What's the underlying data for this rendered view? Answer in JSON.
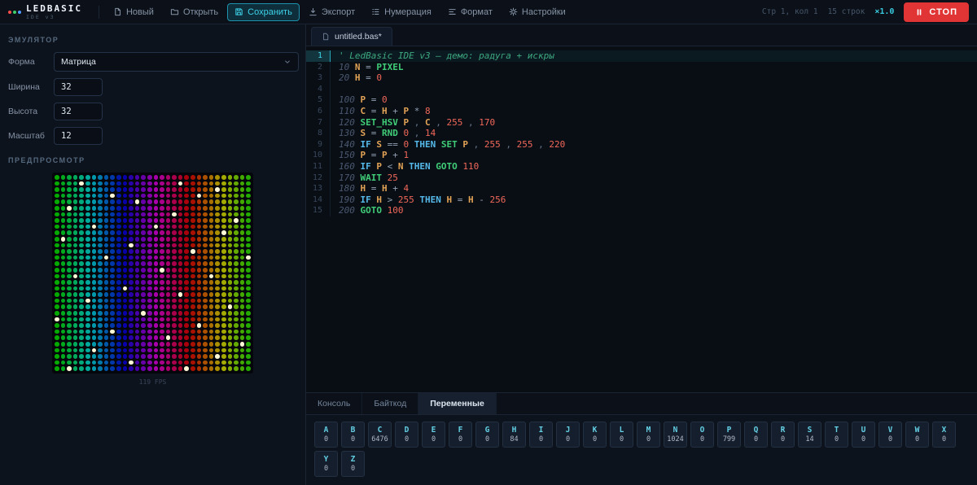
{
  "colors": {
    "accent": "#3ed2e9",
    "stop": "#e13434",
    "spark": "#fff7d6"
  },
  "toolbar": {
    "logo": "LEDBASIC",
    "logo_sub": "IDE v3",
    "logo_dot_colors": [
      "#ff4d4d",
      "#3fd06b",
      "#4d9bff"
    ],
    "buttons": [
      {
        "key": "new",
        "icon": "new-file",
        "label": "Новый"
      },
      {
        "key": "open",
        "icon": "open-folder",
        "label": "Открыть"
      },
      {
        "key": "save",
        "icon": "save",
        "label": "Сохранить",
        "active": true
      },
      {
        "key": "export",
        "icon": "export",
        "label": "Экспорт"
      },
      {
        "key": "numbering",
        "icon": "numbering",
        "label": "Нумерация"
      },
      {
        "key": "format",
        "icon": "format",
        "label": "Формат"
      },
      {
        "key": "settings",
        "icon": "gear",
        "label": "Настройки"
      }
    ],
    "cursor_status": "Стр 1, кол 1",
    "line_count": "15 строк",
    "speed": "×1.0",
    "stop_label": "СТОП"
  },
  "sidebar": {
    "emulator_header": "ЭМУЛЯТОР",
    "fields": [
      {
        "key": "shape",
        "label": "Форма",
        "value": "Матрица",
        "type": "select"
      },
      {
        "key": "width",
        "label": "Ширина",
        "value": "32",
        "type": "input"
      },
      {
        "key": "height",
        "label": "Высота",
        "value": "32",
        "type": "input"
      },
      {
        "key": "scale",
        "label": "Масштаб",
        "value": "12",
        "type": "input"
      }
    ],
    "preview_header": "ПРЕДПРОСМОТР",
    "fps": "119 FPS",
    "matrix": {
      "cols": 32,
      "rows": 32,
      "hue_base": 84,
      "hue_step": 8,
      "saturation": 255,
      "brightness": 170,
      "spark_color": "#fff7d6",
      "sparks": [
        [
          4,
          1
        ],
        [
          20,
          1
        ],
        [
          26,
          2
        ],
        [
          9,
          3
        ],
        [
          23,
          3
        ],
        [
          13,
          4
        ],
        [
          2,
          5
        ],
        [
          19,
          6
        ],
        [
          29,
          7
        ],
        [
          6,
          8
        ],
        [
          16,
          8
        ],
        [
          27,
          9
        ],
        [
          1,
          10
        ],
        [
          12,
          11
        ],
        [
          22,
          12
        ],
        [
          8,
          13
        ],
        [
          31,
          13
        ],
        [
          17,
          15
        ],
        [
          3,
          16
        ],
        [
          25,
          16
        ],
        [
          11,
          18
        ],
        [
          20,
          19
        ],
        [
          5,
          20
        ],
        [
          28,
          21
        ],
        [
          14,
          22
        ],
        [
          0,
          23
        ],
        [
          23,
          24
        ],
        [
          9,
          25
        ],
        [
          18,
          26
        ],
        [
          30,
          27
        ],
        [
          6,
          28
        ],
        [
          26,
          29
        ],
        [
          12,
          30
        ],
        [
          2,
          31
        ],
        [
          21,
          31
        ]
      ]
    }
  },
  "editor": {
    "tab_label": "untitled.bas*",
    "lines": [
      {
        "num": 1,
        "active": true,
        "tokens": [
          [
            "c",
            "' LedBasic IDE v3 — демо: радуга + искры"
          ]
        ]
      },
      {
        "num": 2,
        "tokens": [
          [
            "ln",
            "10 "
          ],
          [
            "v",
            "N"
          ],
          [
            "o",
            " = "
          ],
          [
            "f",
            "PIXEL"
          ]
        ]
      },
      {
        "num": 3,
        "tokens": [
          [
            "ln",
            "20 "
          ],
          [
            "v",
            "H"
          ],
          [
            "o",
            " = "
          ],
          [
            "n",
            "0"
          ]
        ]
      },
      {
        "num": 4,
        "tokens": []
      },
      {
        "num": 5,
        "tokens": [
          [
            "ln",
            "100 "
          ],
          [
            "v",
            "P"
          ],
          [
            "o",
            " = "
          ],
          [
            "n",
            "0"
          ]
        ]
      },
      {
        "num": 6,
        "tokens": [
          [
            "ln",
            "110 "
          ],
          [
            "v",
            "C"
          ],
          [
            "o",
            " = "
          ],
          [
            "v",
            "H"
          ],
          [
            "o",
            " + "
          ],
          [
            "v",
            "P"
          ],
          [
            "o",
            " * "
          ],
          [
            "n",
            "8"
          ]
        ]
      },
      {
        "num": 7,
        "tokens": [
          [
            "ln",
            "120 "
          ],
          [
            "f",
            "SET_HSV"
          ],
          [
            "o",
            " "
          ],
          [
            "v",
            "P"
          ],
          [
            "p",
            " , "
          ],
          [
            "v",
            "C"
          ],
          [
            "p",
            " , "
          ],
          [
            "n",
            "255"
          ],
          [
            "p",
            " , "
          ],
          [
            "n",
            "170"
          ]
        ]
      },
      {
        "num": 8,
        "tokens": [
          [
            "ln",
            "130 "
          ],
          [
            "v",
            "S"
          ],
          [
            "o",
            " = "
          ],
          [
            "f",
            "RND"
          ],
          [
            "o",
            " "
          ],
          [
            "n",
            "0"
          ],
          [
            "p",
            " , "
          ],
          [
            "n",
            "14"
          ]
        ]
      },
      {
        "num": 9,
        "tokens": [
          [
            "ln",
            "140 "
          ],
          [
            "k",
            "IF"
          ],
          [
            "o",
            " "
          ],
          [
            "v",
            "S"
          ],
          [
            "o",
            " == "
          ],
          [
            "n",
            "0"
          ],
          [
            "o",
            " "
          ],
          [
            "k",
            "THEN"
          ],
          [
            "o",
            " "
          ],
          [
            "f",
            "SET"
          ],
          [
            "o",
            " "
          ],
          [
            "v",
            "P"
          ],
          [
            "p",
            " , "
          ],
          [
            "n",
            "255"
          ],
          [
            "p",
            " , "
          ],
          [
            "n",
            "255"
          ],
          [
            "p",
            " , "
          ],
          [
            "n",
            "220"
          ]
        ]
      },
      {
        "num": 10,
        "tokens": [
          [
            "ln",
            "150 "
          ],
          [
            "v",
            "P"
          ],
          [
            "o",
            " = "
          ],
          [
            "v",
            "P"
          ],
          [
            "o",
            " + "
          ],
          [
            "n",
            "1"
          ]
        ]
      },
      {
        "num": 11,
        "tokens": [
          [
            "ln",
            "160 "
          ],
          [
            "k",
            "IF"
          ],
          [
            "o",
            " "
          ],
          [
            "v",
            "P"
          ],
          [
            "o",
            " < "
          ],
          [
            "v",
            "N"
          ],
          [
            "o",
            " "
          ],
          [
            "k",
            "THEN"
          ],
          [
            "o",
            " "
          ],
          [
            "f",
            "GOTO"
          ],
          [
            "o",
            " "
          ],
          [
            "n",
            "110"
          ]
        ]
      },
      {
        "num": 12,
        "tokens": [
          [
            "ln",
            "170 "
          ],
          [
            "f",
            "WAIT"
          ],
          [
            "o",
            " "
          ],
          [
            "n",
            "25"
          ]
        ]
      },
      {
        "num": 13,
        "tokens": [
          [
            "ln",
            "180 "
          ],
          [
            "v",
            "H"
          ],
          [
            "o",
            " = "
          ],
          [
            "v",
            "H"
          ],
          [
            "o",
            " + "
          ],
          [
            "n",
            "4"
          ]
        ]
      },
      {
        "num": 14,
        "tokens": [
          [
            "ln",
            "190 "
          ],
          [
            "k",
            "IF"
          ],
          [
            "o",
            " "
          ],
          [
            "v",
            "H"
          ],
          [
            "o",
            " > "
          ],
          [
            "n",
            "255"
          ],
          [
            "o",
            " "
          ],
          [
            "k",
            "THEN"
          ],
          [
            "o",
            " "
          ],
          [
            "v",
            "H"
          ],
          [
            "o",
            " = "
          ],
          [
            "v",
            "H"
          ],
          [
            "o",
            " - "
          ],
          [
            "n",
            "256"
          ]
        ]
      },
      {
        "num": 15,
        "tokens": [
          [
            "ln",
            "200 "
          ],
          [
            "f",
            "GOTO"
          ],
          [
            "o",
            " "
          ],
          [
            "n",
            "100"
          ]
        ]
      }
    ]
  },
  "bottom": {
    "tabs": [
      {
        "key": "console",
        "label": "Консоль"
      },
      {
        "key": "bytecode",
        "label": "Байткод"
      },
      {
        "key": "variables",
        "label": "Переменные",
        "active": true
      }
    ],
    "variables": [
      {
        "name": "A",
        "value": "0"
      },
      {
        "name": "B",
        "value": "0"
      },
      {
        "name": "C",
        "value": "6476"
      },
      {
        "name": "D",
        "value": "0"
      },
      {
        "name": "E",
        "value": "0"
      },
      {
        "name": "F",
        "value": "0"
      },
      {
        "name": "G",
        "value": "0"
      },
      {
        "name": "H",
        "value": "84"
      },
      {
        "name": "I",
        "value": "0"
      },
      {
        "name": "J",
        "value": "0"
      },
      {
        "name": "K",
        "value": "0"
      },
      {
        "name": "L",
        "value": "0"
      },
      {
        "name": "M",
        "value": "0"
      },
      {
        "name": "N",
        "value": "1024"
      },
      {
        "name": "O",
        "value": "0"
      },
      {
        "name": "P",
        "value": "799"
      },
      {
        "name": "Q",
        "value": "0"
      },
      {
        "name": "R",
        "value": "0"
      },
      {
        "name": "S",
        "value": "14"
      },
      {
        "name": "T",
        "value": "0"
      },
      {
        "name": "U",
        "value": "0"
      },
      {
        "name": "V",
        "value": "0"
      },
      {
        "name": "W",
        "value": "0"
      },
      {
        "name": "X",
        "value": "0"
      },
      {
        "name": "Y",
        "value": "0"
      },
      {
        "name": "Z",
        "value": "0"
      }
    ]
  }
}
